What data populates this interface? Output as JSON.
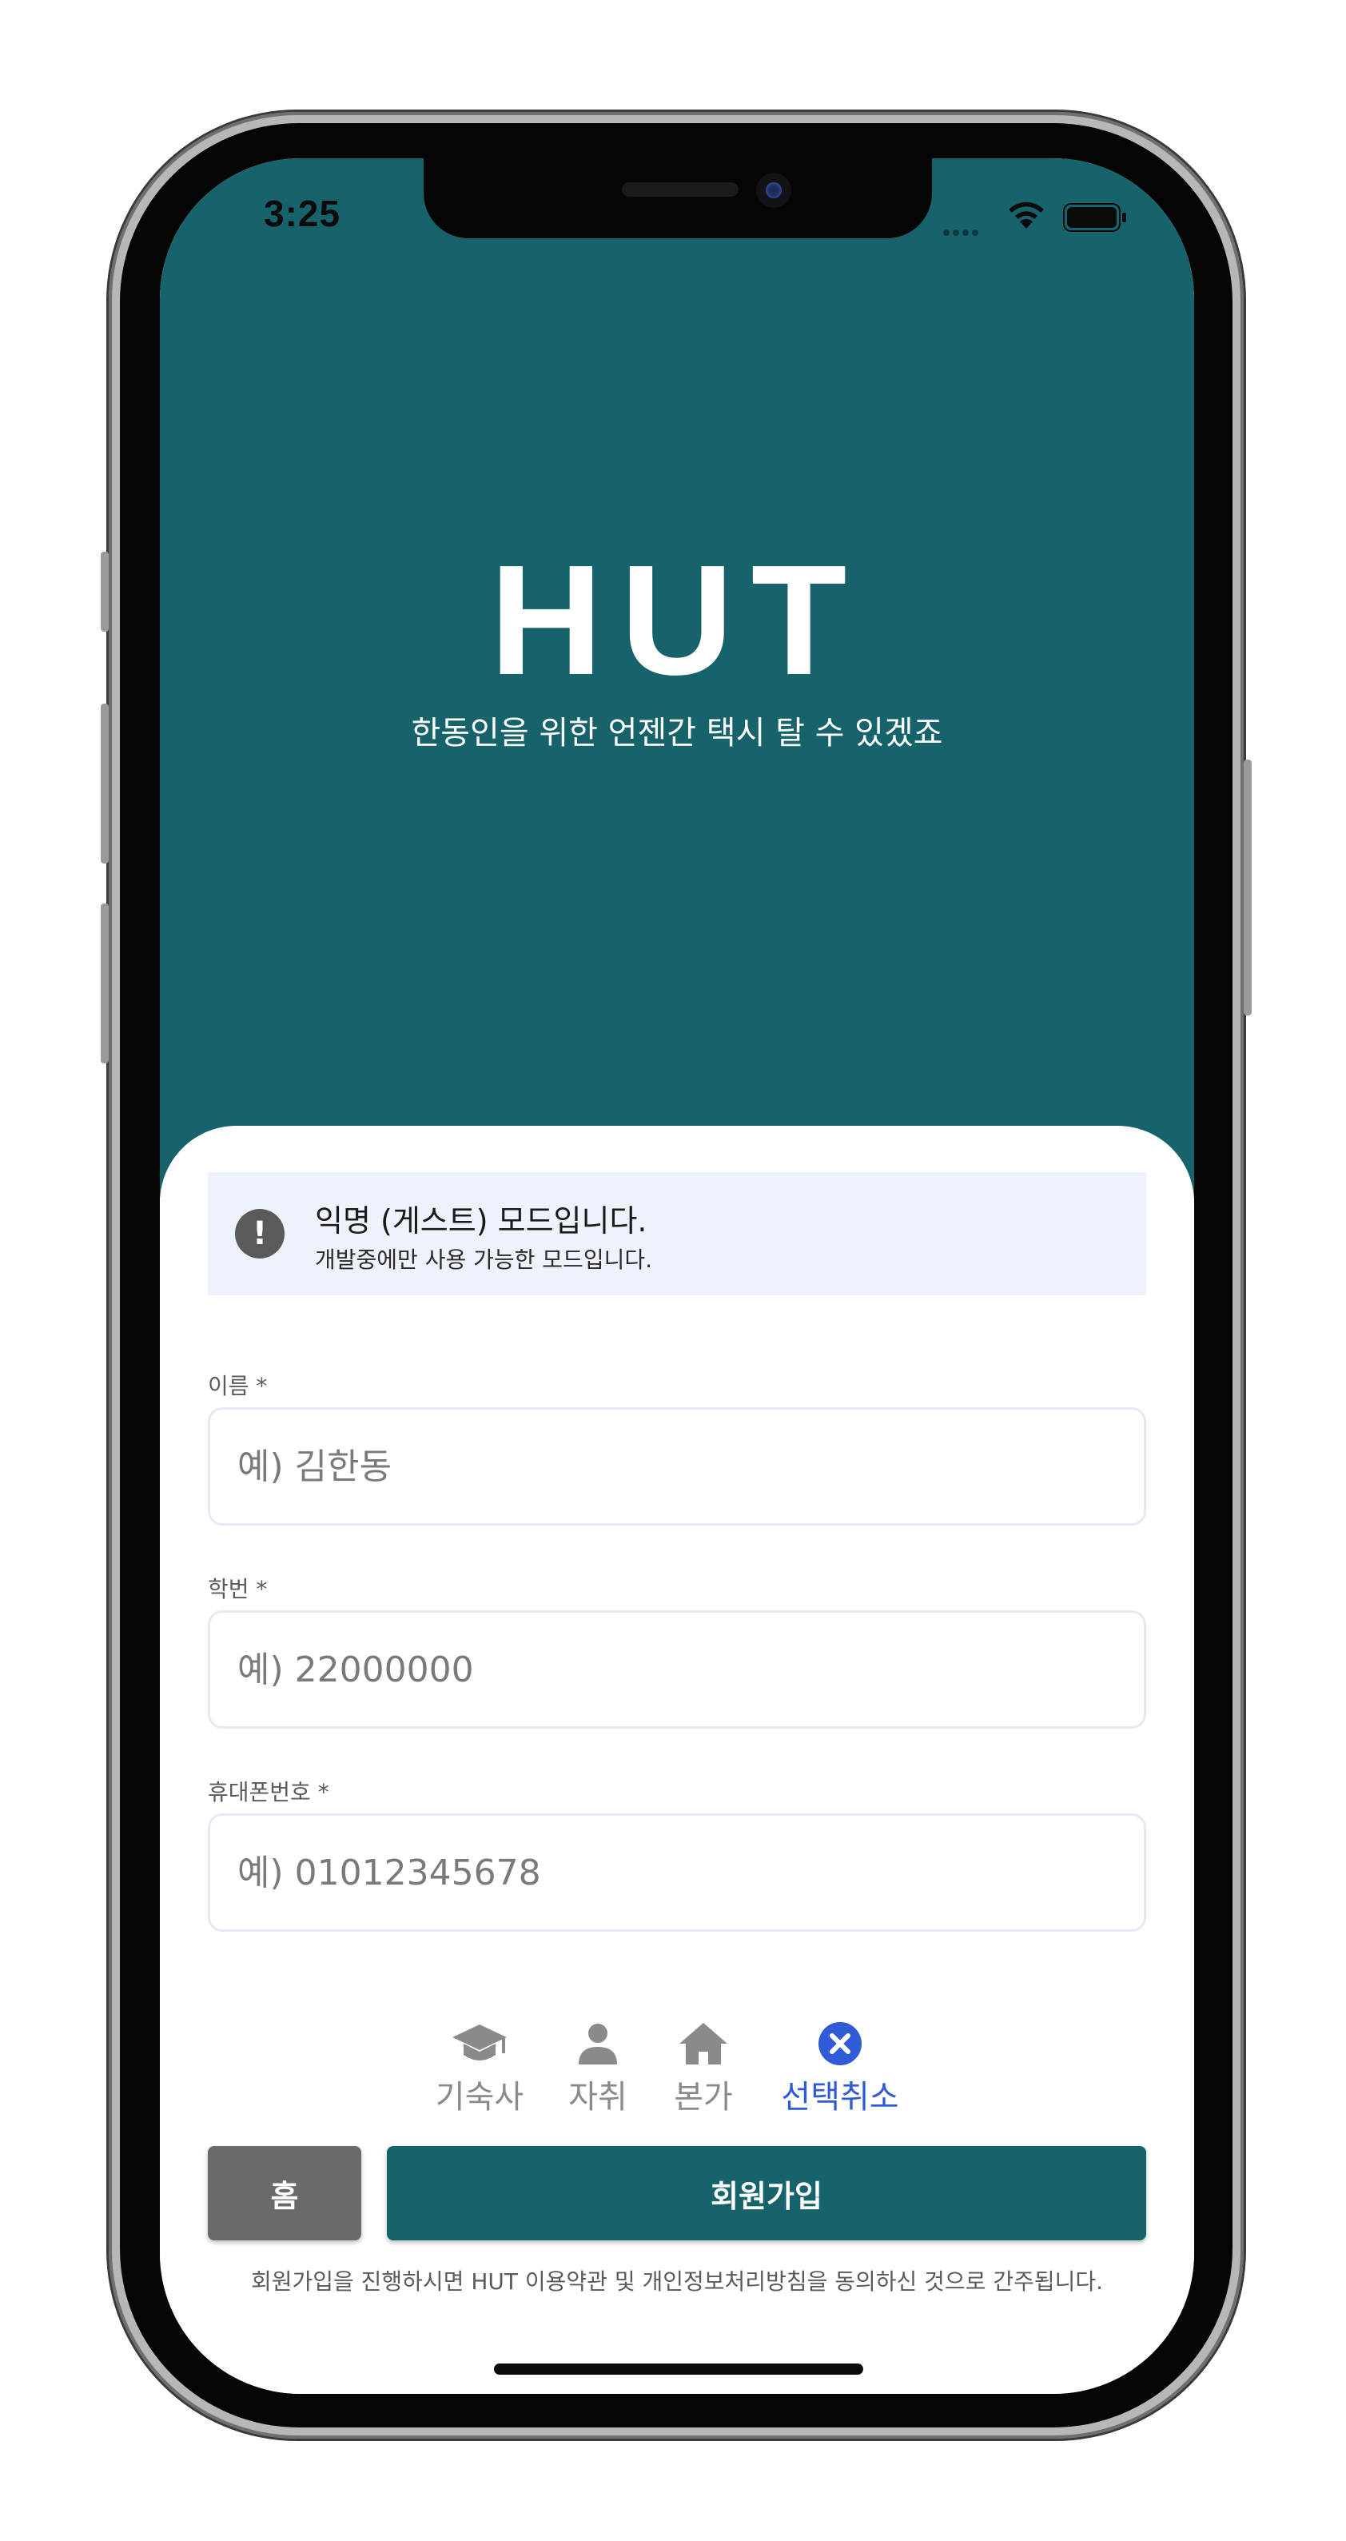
{
  "status_bar": {
    "time": "3:25"
  },
  "hero": {
    "title": "HUT",
    "subtitle": "한동인을 위한 언젠간 택시 탈 수 있겠죠"
  },
  "alert": {
    "icon": "exclamation-icon",
    "title": "익명 (게스트) 모드입니다.",
    "description": "개발중에만 사용 가능한 모드입니다."
  },
  "form": {
    "name": {
      "label": "이름 *",
      "placeholder": "예) 김한동"
    },
    "student_id": {
      "label": "학번 *",
      "placeholder": "예) 22000000"
    },
    "phone": {
      "label": "휴대폰번호 *",
      "placeholder": "예) 01012345678"
    }
  },
  "housing_options": [
    {
      "label": "기숙사",
      "icon": "graduation-cap-icon"
    },
    {
      "label": "자취",
      "icon": "person-icon"
    },
    {
      "label": "본가",
      "icon": "house-icon"
    },
    {
      "label": "선택취소",
      "icon": "close-circle-icon"
    }
  ],
  "buttons": {
    "home": "홈",
    "signup": "회원가입"
  },
  "terms": "회원가입을 진행하시면 HUT 이용약관 및 개인정보처리방침을 동의하신 것으로 간주됩니다.",
  "colors": {
    "primary": "#17636b",
    "alert_bg": "#eef2fb",
    "active_accent": "#2f5bd6",
    "home_button": "#6a6a6a"
  }
}
